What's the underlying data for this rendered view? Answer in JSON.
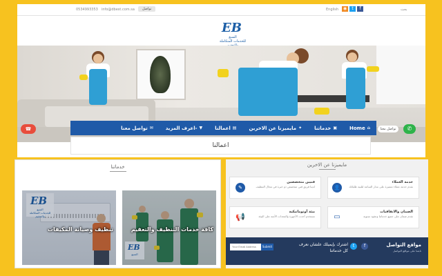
{
  "topbar": {
    "phone": "0534993353",
    "email": "info@dbest.com.sa",
    "contact_label": "تواصل",
    "language": "English",
    "search_label": "بحث",
    "social": [
      {
        "name": "rss-icon",
        "glyph": "◉",
        "color": "#f08a24"
      },
      {
        "name": "twitter-icon",
        "glyph": "t",
        "color": "#1da1f2"
      },
      {
        "name": "facebook-icon",
        "glyph": "f",
        "color": "#3b5998"
      }
    ]
  },
  "logo": {
    "mark": "EB",
    "line1": "السبع",
    "line2": "للخدمات المتكاملة والتعقيم"
  },
  "floating": {
    "whatsapp_icon": "whatsapp-icon",
    "whatsapp_glyph": "✆",
    "pill_label": "تواصل معنا",
    "left_glyph": "☎"
  },
  "nav": {
    "items": [
      {
        "label": "Home",
        "icon": "home-icon",
        "glyph": "⌂"
      },
      {
        "label": "خدماتنا",
        "icon": "services-icon",
        "glyph": "▣"
      },
      {
        "label": "مايميزنا عن الاخرين",
        "icon": "star-icon",
        "glyph": "✦"
      },
      {
        "label": "اعمالنا",
        "icon": "works-icon",
        "glyph": "▤"
      },
      {
        "label": "اعرف المزيد-",
        "icon": "more-icon",
        "glyph": "▼"
      },
      {
        "label": "تواصل معنا",
        "icon": "mail-icon",
        "glyph": "✉"
      }
    ]
  },
  "subtitle": "اعمالنا",
  "services": {
    "title": "خدماتنا",
    "cards": [
      {
        "label": "تنظيف وصيانة المكيفات"
      },
      {
        "label": "كافة خدمات التنظيف والتعقيم"
      }
    ]
  },
  "features": {
    "title": "مايميزنا عن الاخرين",
    "items": [
      {
        "title": "خدمة العملاء",
        "desc": "نقدم خدمة عملاء متميزة على مدار الساعة لتلبية طلباتك",
        "icon": "user-icon",
        "glyph": "👤"
      },
      {
        "title": "فنيين متخصصين",
        "desc": "لدينا فريق فني متخصص ذو خبرة في مجال التنظيف",
        "icon": "tools-icon",
        "glyph": "✎"
      },
      {
        "title": "الضمان والاتفاقيات",
        "desc": "نقدم ضمان على جميع خدماتنا وعقود سنوية",
        "icon": "monitor-icon",
        "glyph": "▭"
      },
      {
        "title": "بيئة أوتوماتيكية",
        "desc": "نستخدم أحدث الأجهزة والمعدات الآمنة على البيئة",
        "icon": "megaphone-icon",
        "glyph": "📢"
      }
    ]
  },
  "footer": {
    "title": "مواقع التواصل",
    "subtitle": "تابعنا على مواقع التواصل",
    "newsletter": "اشترك بإيميلك علشان نعرف كل خدماتنا",
    "email_placeholder": "Your Email Address",
    "submit_label": "Submit"
  }
}
